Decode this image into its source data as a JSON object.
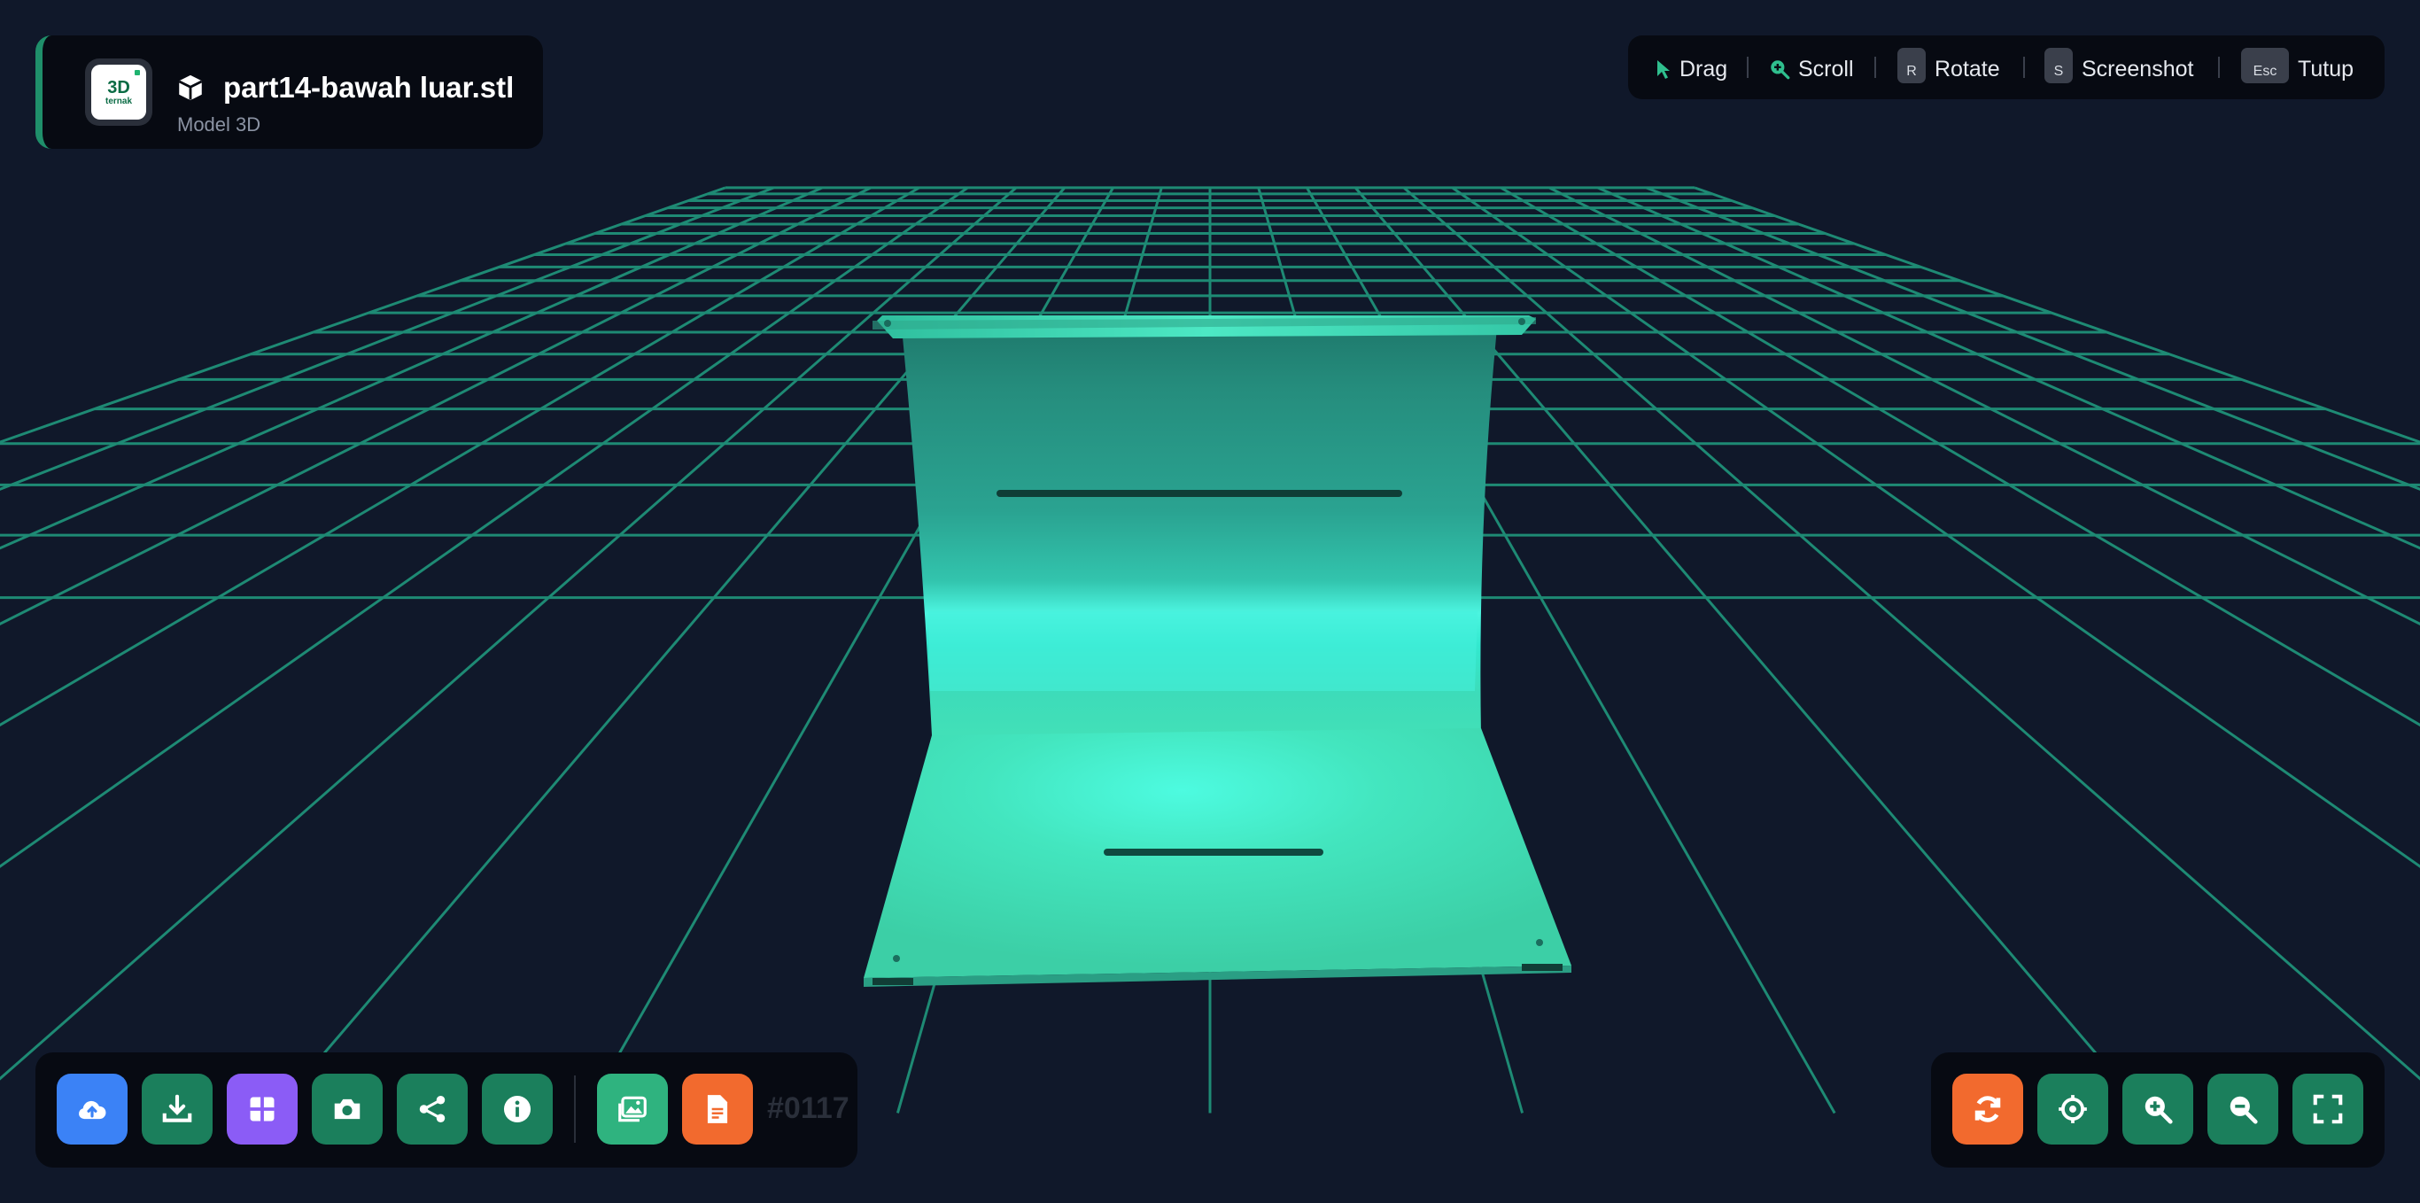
{
  "header": {
    "logo_text": "3D",
    "logo_subtext": "ternak",
    "file_name": "part14-bawah luar.stl",
    "file_type": "Model 3D"
  },
  "hints": [
    {
      "key": "",
      "label": "Drag",
      "icon": "pointer-icon"
    },
    {
      "key": "",
      "label": "Scroll",
      "icon": "zoom-icon"
    },
    {
      "key": "R",
      "label": "Rotate"
    },
    {
      "key": "S",
      "label": "Screenshot"
    },
    {
      "key": "Esc",
      "label": "Tutup"
    }
  ],
  "toolbar_left": [
    {
      "name": "upload-button",
      "icon": "cloud-upload-icon",
      "color": "#3b82f6"
    },
    {
      "name": "download-button",
      "icon": "download-icon",
      "color": "#1b7f5c"
    },
    {
      "name": "grid-toggle-button",
      "icon": "grid-icon",
      "color": "#8b5cf6"
    },
    {
      "name": "screenshot-button",
      "icon": "camera-icon",
      "color": "#1b7f5c"
    },
    {
      "name": "share-button",
      "icon": "share-icon",
      "color": "#1b7f5c"
    },
    {
      "name": "info-button",
      "icon": "info-icon",
      "color": "#1b7f5c"
    },
    {
      "name": "gallery-button",
      "icon": "image-icon",
      "color": "#2fb37f"
    },
    {
      "name": "document-button",
      "icon": "document-icon",
      "color": "#f26a2e"
    }
  ],
  "counter": "#0117",
  "toolbar_right": [
    {
      "name": "auto-rotate-button",
      "icon": "refresh-icon",
      "color": "#f26a2e"
    },
    {
      "name": "recenter-button",
      "icon": "crosshair-icon",
      "color": "#1b7f5c"
    },
    {
      "name": "zoom-in-button",
      "icon": "zoom-in-icon",
      "color": "#1b7f5c"
    },
    {
      "name": "zoom-out-button",
      "icon": "zoom-out-icon",
      "color": "#1b7f5c"
    },
    {
      "name": "fullscreen-button",
      "icon": "fullscreen-icon",
      "color": "#1b7f5c"
    }
  ],
  "colors": {
    "background": "#10182a",
    "grid": "#1e8a74",
    "model": "#3ed8b4",
    "accent": "#1f8f6a"
  }
}
